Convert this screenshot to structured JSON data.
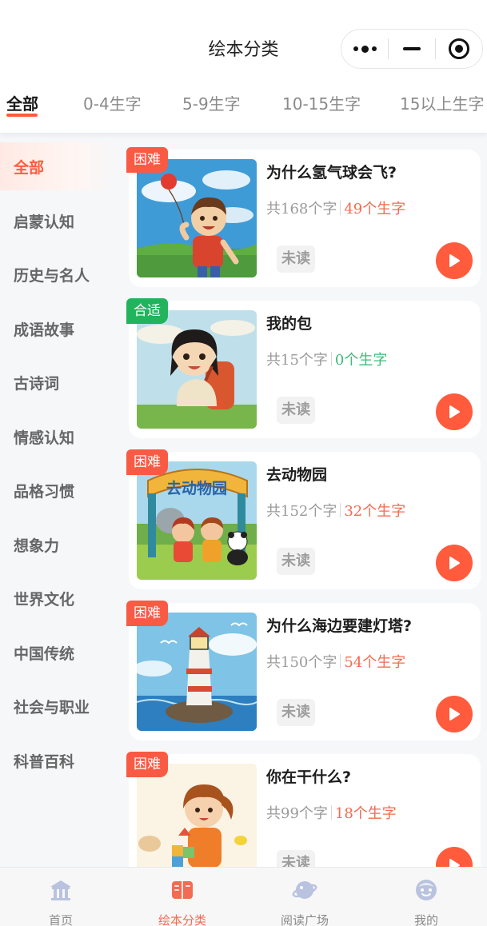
{
  "header": {
    "title": "绘本分类"
  },
  "tabs": [
    {
      "label": "全部",
      "active": true
    },
    {
      "label": "0-4生字"
    },
    {
      "label": "5-9生字"
    },
    {
      "label": "10-15生字"
    },
    {
      "label": "15以上生字"
    }
  ],
  "sidebar": {
    "items": [
      {
        "label": "全部",
        "active": true
      },
      {
        "label": "启蒙认知"
      },
      {
        "label": "历史与名人"
      },
      {
        "label": "成语故事"
      },
      {
        "label": "古诗词"
      },
      {
        "label": "情感认知"
      },
      {
        "label": "品格习惯"
      },
      {
        "label": "想象力"
      },
      {
        "label": "世界文化"
      },
      {
        "label": "中国传统"
      },
      {
        "label": "社会与职业"
      },
      {
        "label": "科普百科"
      }
    ]
  },
  "books": [
    {
      "title": "为什么氢气球会飞?",
      "level": "困难",
      "total": "共168个字",
      "new_words": "49个生字",
      "status": "未读"
    },
    {
      "title": "我的包",
      "level": "合适",
      "total": "共15个字",
      "new_words": "0个生字",
      "status": "未读"
    },
    {
      "title": "去动物园",
      "level": "困难",
      "total": "共152个字",
      "new_words": "32个生字",
      "status": "未读"
    },
    {
      "title": "为什么海边要建灯塔?",
      "level": "困难",
      "total": "共150个字",
      "new_words": "54个生字",
      "status": "未读"
    },
    {
      "title": "你在干什么?",
      "level": "困难",
      "total": "共99个字",
      "new_words": "18个生字",
      "status": "未读"
    }
  ],
  "cover_art": {
    "zoo_sign": "去动物园"
  },
  "bottom_nav": [
    {
      "label": "首页",
      "icon": "home-icon"
    },
    {
      "label": "绘本分类",
      "icon": "book-icon",
      "active": true
    },
    {
      "label": "阅读广场",
      "icon": "planet-icon"
    },
    {
      "label": "我的",
      "icon": "face-icon"
    }
  ],
  "colors": {
    "accent": "#ff5b3c",
    "hard_badge": "#f95a44",
    "fit_badge": "#21b45c",
    "new_words_red": "#f56a4f",
    "new_words_green": "#3dbb7a"
  }
}
